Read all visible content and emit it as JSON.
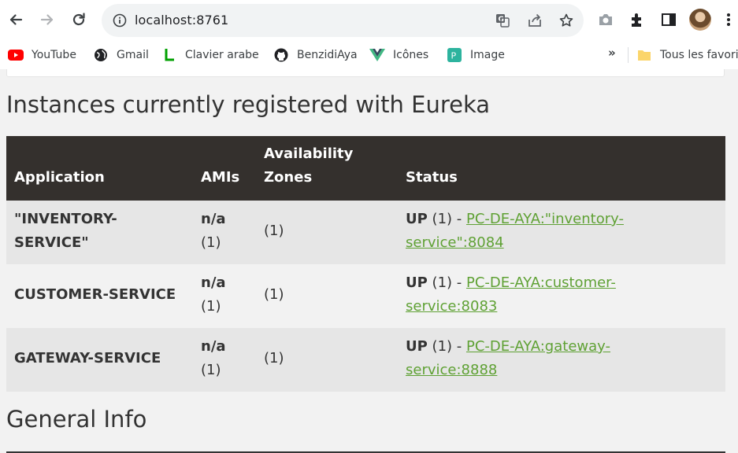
{
  "browser": {
    "url": "localhost:8761",
    "bookmarks": [
      {
        "label": "YouTube",
        "icon": "youtube-icon"
      },
      {
        "label": "Gmail",
        "icon": "globe-icon"
      },
      {
        "label": "Clavier arabe",
        "icon": "l-green-icon"
      },
      {
        "label": "BenzidiAya",
        "icon": "github-icon"
      },
      {
        "label": "Icônes",
        "icon": "vue-icon"
      },
      {
        "label": "Image",
        "icon": "image-icon"
      }
    ],
    "more_label": "»",
    "all_bookmarks_label": "Tous les favoris"
  },
  "main": {
    "instances_title": "Instances currently registered with Eureka",
    "general_info_title": "General Info",
    "table": {
      "headers": {
        "application": "Application",
        "amis": "AMIs",
        "availability_line1": "Availability",
        "availability_line2": "Zones",
        "status": "Status"
      },
      "rows": [
        {
          "app_line1": "\"INVENTORY-",
          "app_line2": "SERVICE\"",
          "ami": "n/a",
          "ami_count": "(1)",
          "zones": "(1)",
          "status": "UP",
          "status_count": "(1) - ",
          "link_line1": "PC-DE-AYA:\"inventory-",
          "link_line2": "service\":8084"
        },
        {
          "app_line1": "CUSTOMER-SERVICE",
          "app_line2": "",
          "ami": "n/a",
          "ami_count": "(1)",
          "zones": "(1)",
          "status": "UP",
          "status_count": "(1) - ",
          "link_line1": "PC-DE-AYA:customer-",
          "link_line2": "service:8083"
        },
        {
          "app_line1": "GATEWAY-SERVICE",
          "app_line2": "",
          "ami": "n/a",
          "ami_count": "(1)",
          "zones": "(1)",
          "status": "UP",
          "status_count": "(1) - ",
          "link_line1": "PC-DE-AYA:gateway-",
          "link_line2": "service:8888"
        }
      ]
    }
  },
  "colors": {
    "header_bg": "#34302d",
    "row_bg": "#e6e6e6",
    "link": "#5fa134",
    "page_bg": "#f2f2f2"
  }
}
